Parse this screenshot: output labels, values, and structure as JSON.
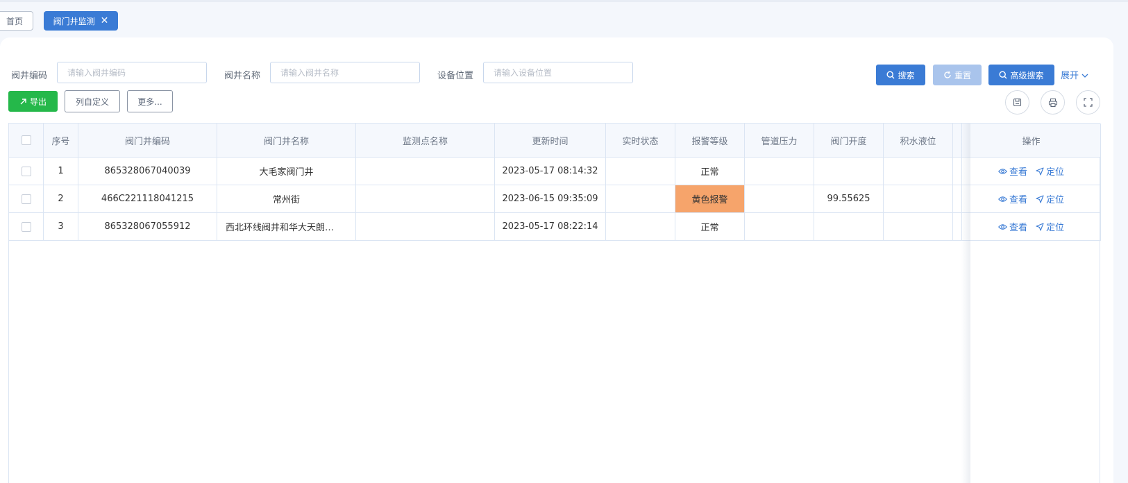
{
  "tabs": {
    "home": "首页",
    "active": "阀门井监测"
  },
  "filters": {
    "code": {
      "label": "阀井编码",
      "placeholder": "请输入阀井编码",
      "value": ""
    },
    "name": {
      "label": "阀井名称",
      "placeholder": "请输入阀井名称",
      "value": ""
    },
    "location": {
      "label": "设备位置",
      "placeholder": "请输入设备位置",
      "value": ""
    }
  },
  "actions": {
    "search": "搜索",
    "reset": "重置",
    "advanced": "高级搜索",
    "expand": "展开",
    "export": "导出",
    "columns": "列自定义",
    "more": "更多..."
  },
  "table": {
    "headers": [
      "序号",
      "阀门井编码",
      "阀门井名称",
      "监测点名称",
      "更新时间",
      "实时状态",
      "报警等级",
      "管道压力",
      "阀门开度",
      "积水液位",
      "操作"
    ],
    "view_label": "查看",
    "locate_label": "定位",
    "rows": [
      {
        "index": "1",
        "code": "865328067040039",
        "name": "大毛家阀门井",
        "point": "",
        "updated": "2023-05-17 08:14:32",
        "status": "",
        "alarm": "正常",
        "pressure": "",
        "opening": "",
        "water": ""
      },
      {
        "index": "2",
        "code": "466C221118041215",
        "name": "常州街",
        "point": "",
        "updated": "2023-06-15 09:35:09",
        "status": "",
        "alarm": "黄色报警",
        "pressure": "",
        "opening": "99.55625",
        "water": ""
      },
      {
        "index": "3",
        "code": "865328067055912",
        "name": "西北环线阀井和华大天朗…",
        "point": "",
        "updated": "2023-05-17 08:22:14",
        "status": "",
        "alarm": "正常",
        "pressure": "",
        "opening": "",
        "water": ""
      }
    ]
  },
  "colors": {
    "primary": "#3a7bd5",
    "success": "#25b84a",
    "alarm_yellow": "#f6a46b"
  }
}
